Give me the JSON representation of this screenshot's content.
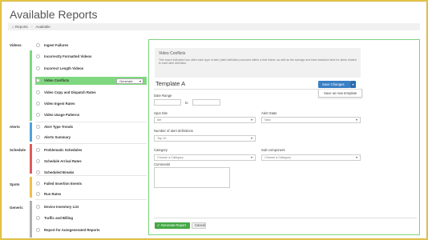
{
  "page_title": "Available Reports",
  "breadcrumb": {
    "home_icon": "home-icon",
    "items": [
      "Reports",
      "Available"
    ],
    "separator": "›"
  },
  "colors": {
    "videos": "#7fd87f",
    "alerts": "#4fa3d9",
    "schedule": "#e05a5a",
    "spots": "#f0c04a",
    "generic": "#b0b0b0",
    "active": "#7fd87f",
    "accent": "#3b7fc4",
    "generate": "#45a845"
  },
  "sidebar": {
    "groups": [
      "Videos",
      "Alerts",
      "Schedule",
      "Spots",
      "Generic"
    ],
    "items": [
      "Ingest Failures",
      "Incorrectly Formatted Videos",
      "Incorrect Length Videos",
      "Video Conflicts",
      "Video Copy and Dispatch Rates",
      "Video Ingest Rates",
      "Video Usage Patterns",
      "Alert Type Trends",
      "Alerts Summary",
      "Problematic Schedules",
      "Schedule Arrival Rates",
      "Scheduled Breaks",
      "Failed Insertion Events",
      "Run Rates",
      "Device Inventory List",
      "Traffic and Billing",
      "Report for Autogenerated Reports"
    ],
    "active_item": "Video Conflicts",
    "generate_label": "Generate"
  },
  "panel": {
    "heading": "Video Conflicts",
    "description": "This report indicates how often each type of alert (alert definition) occurred within a time frame, as well as the average and total resolution time for alerts related to each alert definition.",
    "template_title": "Template A",
    "save_label": "Save Changes",
    "dropdown_item": "Save as new template",
    "date_range_label": "Date Range",
    "to_label": "to",
    "spot_site_label": "Spot Site",
    "spot_site_value": "det",
    "alert_state_label": "Alert State",
    "alert_state_value": "New",
    "num_alert_defs_label": "Number of alert definitions",
    "num_alert_defs_value": "Top 10",
    "category_label": "Category",
    "category_placeholder": "Choose a Category",
    "subcomponent_label": "Sub-component",
    "subcomponent_placeholder": "Choose a Category",
    "comments_label": "Comments",
    "generate_report_label": "Generate Report",
    "cancel_label": "Cancel"
  }
}
